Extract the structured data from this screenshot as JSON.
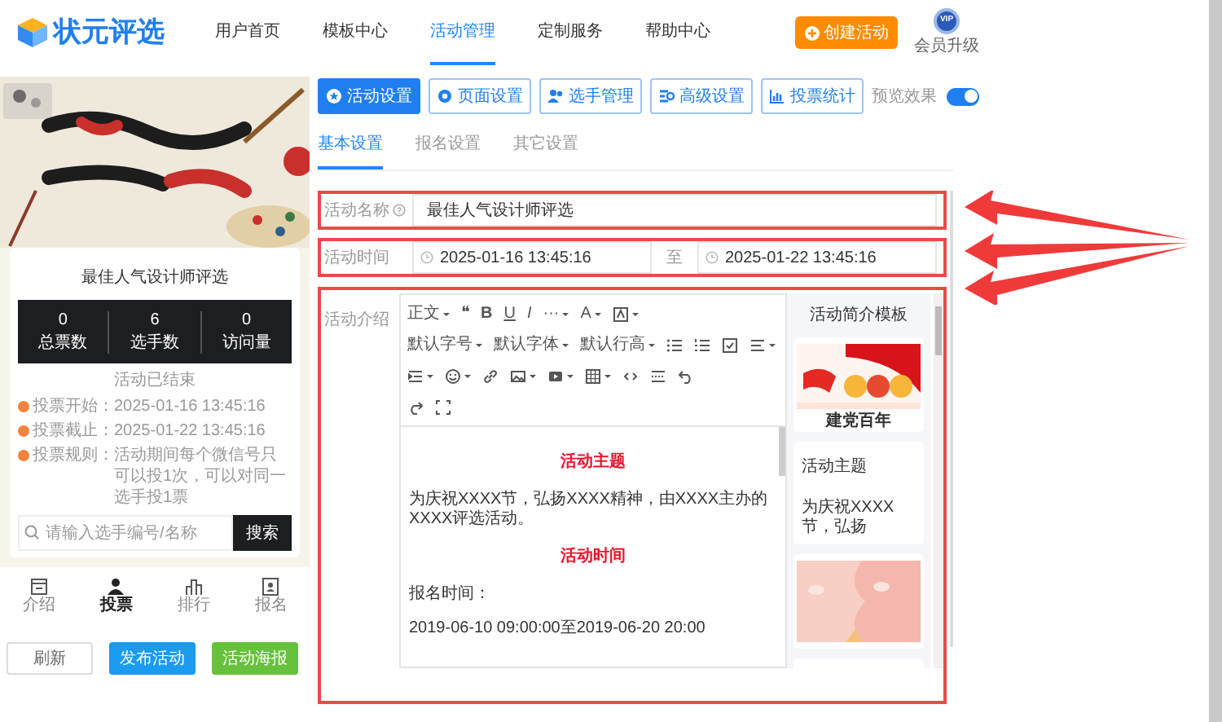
{
  "header": {
    "logo": "状元评选",
    "nav": [
      {
        "label": "用户首页",
        "selected": false
      },
      {
        "label": "模板中心",
        "selected": false
      },
      {
        "label": "活动管理",
        "selected": true
      },
      {
        "label": "定制服务",
        "selected": false
      },
      {
        "label": "帮助中心",
        "selected": false
      }
    ],
    "create_button": "创建活动",
    "vip_badge": "VIP",
    "vip_label": "会员升级"
  },
  "preview": {
    "poster": {
      "kind": "picture"
    },
    "title": "最佳人气设计师评选",
    "stats": [
      {
        "value": "0",
        "label": "总票数"
      },
      {
        "value": "6",
        "label": "选手数"
      },
      {
        "value": "0",
        "label": "访问量"
      }
    ],
    "status": "活动已结束",
    "info": [
      {
        "label": "投票开始：",
        "value": "2025-01-16 13:45:16"
      },
      {
        "label": "投票截止：",
        "value": "2025-01-22 13:45:16"
      },
      {
        "label": "投票规则：",
        "value": "活动期间每个微信号只可以投1次，可以对同一选手投1票"
      }
    ],
    "search": {
      "placeholder": "请输入选手编号/名称",
      "button": "搜索"
    },
    "bottom_nav": [
      {
        "label": "介绍",
        "selected": false
      },
      {
        "label": "投票",
        "selected": true
      },
      {
        "label": "排行",
        "selected": false
      },
      {
        "label": "报名",
        "selected": false
      }
    ],
    "buttons": [
      {
        "label": "刷新",
        "kind": "plain"
      },
      {
        "label": "发布活动",
        "kind": "primary"
      },
      {
        "label": "活动海报",
        "kind": "success"
      }
    ]
  },
  "main": {
    "tool_buttons": [
      {
        "label": "活动设置",
        "selected": true
      },
      {
        "label": "页面设置",
        "selected": false
      },
      {
        "label": "选手管理",
        "selected": false
      },
      {
        "label": "高级设置",
        "selected": false
      },
      {
        "label": "投票统计",
        "selected": false
      }
    ],
    "preview_toggle": {
      "label": "预览效果",
      "on": true
    },
    "tabs": [
      {
        "label": "基本设置",
        "selected": true
      },
      {
        "label": "报名设置",
        "selected": false
      },
      {
        "label": "其它设置",
        "selected": false
      }
    ],
    "form": {
      "name_label": "活动名称",
      "name_value": "最佳人气设计师评选",
      "time_label": "活动时间",
      "start": "2025-01-16 13:45:16",
      "separator": "至",
      "end": "2025-01-22 13:45:16",
      "intro_label": "活动介绍",
      "toolbar": [
        [
          {
            "kind": "dropdown",
            "label": "正文"
          },
          {
            "kind": "glyph",
            "label": "❝"
          },
          {
            "kind": "glyph",
            "label": "B"
          },
          {
            "kind": "glyph",
            "label": "U"
          },
          {
            "kind": "glyph",
            "label": "I"
          },
          {
            "kind": "dropdown",
            "label": "···"
          },
          {
            "kind": "dropdown",
            "label": "A"
          },
          {
            "kind": "icon-dropdown"
          }
        ],
        [
          {
            "kind": "dropdown",
            "label": "默认字号"
          },
          {
            "kind": "dropdown",
            "label": "默认字体"
          },
          {
            "kind": "dropdown",
            "label": "默认行高"
          },
          {
            "kind": "icon"
          },
          {
            "kind": "icon"
          },
          {
            "kind": "icon"
          },
          {
            "kind": "icon-dropdown"
          }
        ],
        [
          {
            "kind": "icon-dropdown"
          },
          {
            "kind": "icon-dropdown"
          },
          {
            "kind": "icon"
          },
          {
            "kind": "icon-dropdown"
          },
          {
            "kind": "icon-dropdown"
          },
          {
            "kind": "icon-dropdown"
          },
          {
            "kind": "icon"
          },
          {
            "kind": "icon"
          },
          {
            "kind": "icon"
          }
        ],
        [
          {
            "kind": "icon"
          },
          {
            "kind": "icon"
          }
        ]
      ],
      "content": [
        {
          "kind": "heading",
          "text": "活动主题"
        },
        {
          "kind": "text",
          "text": "为庆祝XXXX节，弘扬XXXX精神，由XXXX主办的XXXX评选活动。"
        },
        {
          "kind": "heading",
          "text": "活动时间"
        },
        {
          "kind": "text",
          "text": "报名时间："
        },
        {
          "kind": "text",
          "text": "2019-06-10 09:00:00至2019-06-20 20:00"
        }
      ],
      "templates_title": "活动简介模板",
      "templates": [
        {
          "kind": "picture",
          "caption": "建党百年"
        },
        {
          "kind": "text",
          "title": "活动主题",
          "snippet": "为庆祝XXXX节，弘扬"
        },
        {
          "kind": "picture"
        },
        {
          "kind": "blank"
        }
      ]
    }
  }
}
